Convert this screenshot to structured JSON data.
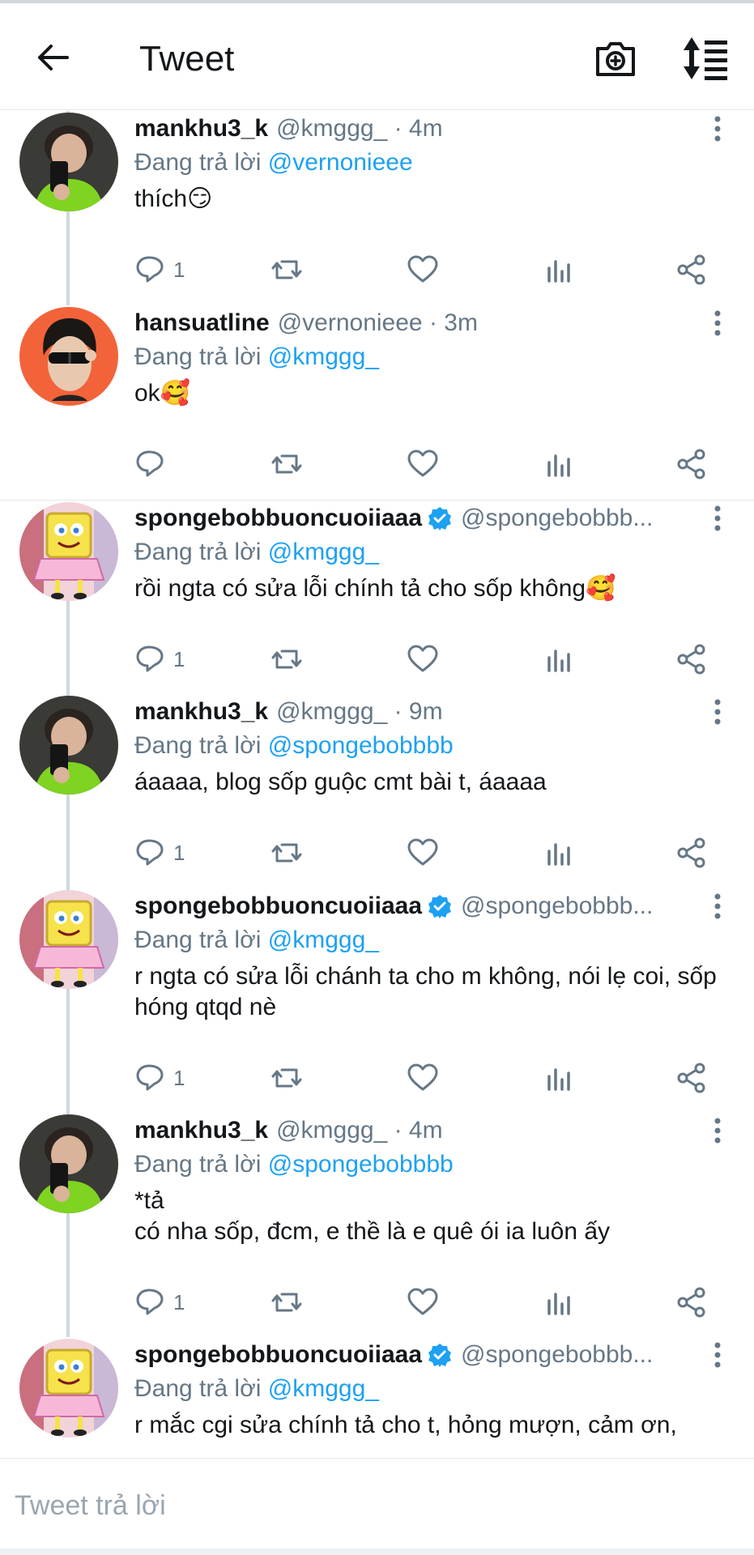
{
  "header": {
    "title": "Tweet"
  },
  "composer": {
    "placeholder": "Tweet trả lời"
  },
  "tweets": [
    {
      "name": "mankhu3_k",
      "handle": "@kmggg_ · 4m",
      "replying_prefix": "Đang trả lời ",
      "replying_to": "@vernonieee",
      "text": "thích😏",
      "reply_count": "1",
      "verified": false,
      "avatar": "mankhu"
    },
    {
      "name": "hansuatline",
      "handle": "@vernonieee · 3m",
      "replying_prefix": "Đang trả lời ",
      "replying_to": "@kmggg_",
      "text": "ok🥰",
      "reply_count": "",
      "verified": false,
      "avatar": "hansuat"
    },
    {
      "name": "spongebobbuoncuoiiaaa",
      "handle": "@spongebobbb...",
      "replying_prefix": "Đang trả lời ",
      "replying_to": "@kmggg_",
      "text": "rồi ngta có sửa lỗi chính tả cho sốp không🥰",
      "reply_count": "1",
      "verified": true,
      "avatar": "sponge"
    },
    {
      "name": "mankhu3_k",
      "handle": "@kmggg_ · 9m",
      "replying_prefix": "Đang trả lời ",
      "replying_to": "@spongebobbbb",
      "text": "áaaaa, blog sốp guộc cmt bài t, áaaaa",
      "reply_count": "1",
      "verified": false,
      "avatar": "mankhu"
    },
    {
      "name": "spongebobbuoncuoiiaaa",
      "handle": "@spongebobbb...",
      "replying_prefix": "Đang trả lời ",
      "replying_to": "@kmggg_",
      "text": "r ngta có sửa lỗi chánh ta cho m không, nói lẹ coi, sốp hóng qtqd nè",
      "reply_count": "1",
      "verified": true,
      "avatar": "sponge"
    },
    {
      "name": "mankhu3_k",
      "handle": "@kmggg_ · 4m",
      "replying_prefix": "Đang trả lời ",
      "replying_to": "@spongebobbbb",
      "text": "*tả\ncó nha sốp, đcm, e thề là e quê ói ia luôn ấy",
      "reply_count": "1",
      "verified": false,
      "avatar": "mankhu"
    },
    {
      "name": "spongebobbuoncuoiiaaa",
      "handle": "@spongebobbb...",
      "replying_prefix": "Đang trả lời ",
      "replying_to": "@kmggg_",
      "text": "r mắc cgi sửa chính tả cho t, hỏng mượn, cảm ơn,",
      "reply_count": "",
      "verified": true,
      "avatar": "sponge"
    }
  ],
  "colors": {
    "accent": "#1da1f2",
    "secondary_text": "#657786",
    "verified": "#1da1f2"
  },
  "icons": [
    "back-arrow-icon",
    "camera-plus-icon",
    "sort-icon",
    "more-vertical-icon",
    "reply-icon",
    "retweet-icon",
    "like-icon",
    "analytics-icon",
    "share-icon",
    "verified-badge-icon"
  ]
}
